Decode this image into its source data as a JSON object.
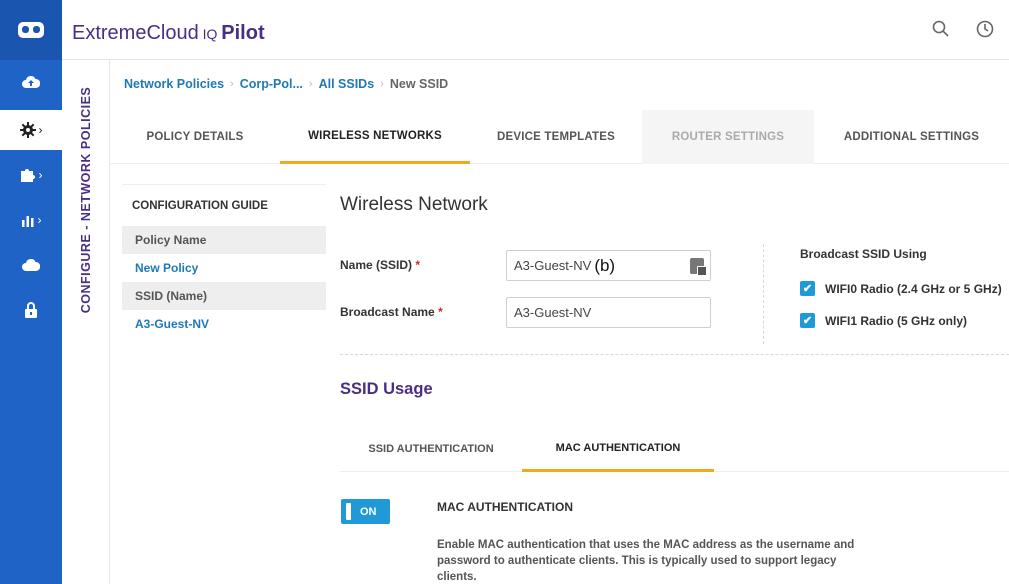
{
  "app": {
    "brand": "ExtremeCloud",
    "brand_suffix": " IQ ",
    "product": "Pilot"
  },
  "section_label": "CONFIGURE - NETWORK POLICIES",
  "rail": {
    "items": [
      {
        "icon": "cloud-upload-icon",
        "glyph": "☁"
      },
      {
        "icon": "gear-icon",
        "glyph": "✱",
        "active": true
      },
      {
        "icon": "puzzle-icon",
        "glyph": "✚"
      },
      {
        "icon": "bar-chart-icon",
        "glyph": "▮"
      },
      {
        "icon": "cloud-icon",
        "glyph": "☁"
      },
      {
        "icon": "lock-icon",
        "glyph": "🔒"
      }
    ]
  },
  "breadcrumb": {
    "items": [
      "Network Policies",
      "Corp-Pol...",
      "All SSIDs"
    ],
    "current": "New SSID"
  },
  "tabs": [
    {
      "label": "POLICY DETAILS"
    },
    {
      "label": "WIRELESS NETWORKS",
      "active": true
    },
    {
      "label": "DEVICE TEMPLATES"
    },
    {
      "label": "ROUTER SETTINGS",
      "disabled": true
    },
    {
      "label": "ADDITIONAL SETTINGS"
    }
  ],
  "guide": {
    "title": "CONFIGURATION GUIDE",
    "rows": [
      {
        "label": "Policy Name",
        "value": "New Policy"
      },
      {
        "label": "SSID (Name)",
        "value": "A3-Guest-NV"
      }
    ]
  },
  "wireless": {
    "title": "Wireless Network",
    "ssid_label": "Name (SSID)",
    "ssid_value": "A3-Guest-NV",
    "ssid_annotation": "(b)",
    "broadcast_label": "Broadcast Name",
    "broadcast_value": "A3-Guest-NV",
    "required_mark": "*",
    "broadcast_using": {
      "title": "Broadcast SSID Using",
      "options": [
        {
          "label": "WIFI0 Radio (2.4 GHz or 5 GHz)",
          "checked": true
        },
        {
          "label": "WIFI1 Radio (5 GHz only)",
          "checked": true
        }
      ]
    }
  },
  "usage": {
    "title": "SSID Usage",
    "subtabs": [
      {
        "label": "SSID AUTHENTICATION"
      },
      {
        "label": "MAC AUTHENTICATION",
        "active": true
      }
    ],
    "toggle_label": "ON",
    "mac_title": "MAC AUTHENTICATION",
    "mac_desc": "Enable MAC authentication that uses the MAC address as the username and password to authenticate clients. This is typically used to support legacy clients."
  },
  "colors": {
    "rail": "#1f63c6",
    "accent": "#f0a81f",
    "brand_purple": "#4a2e86",
    "link": "#1f79b8",
    "checkbox": "#1f9ad6"
  }
}
